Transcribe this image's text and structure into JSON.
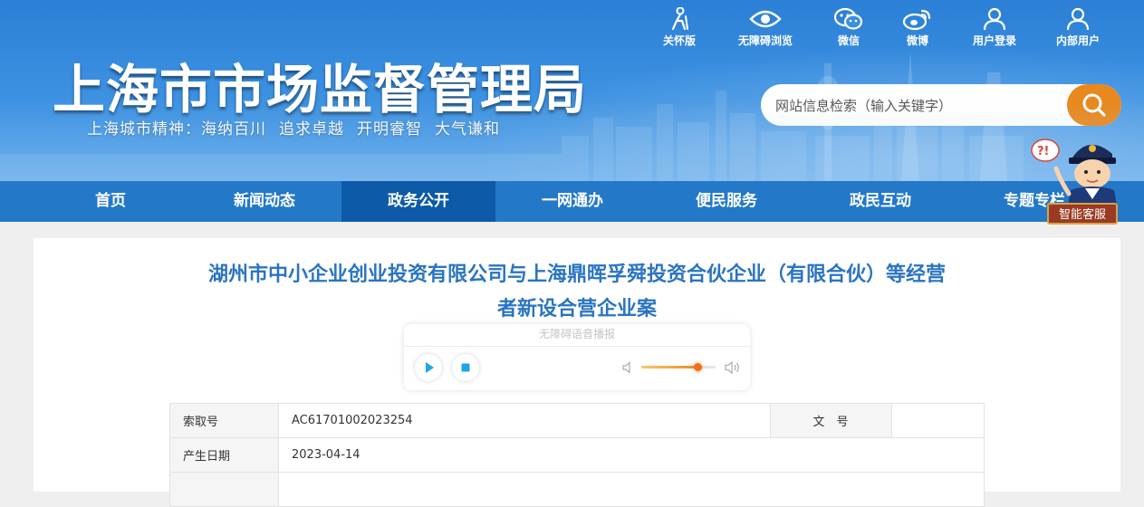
{
  "header": {
    "site_title": "上海市市场监督管理局",
    "motto_prefix": "上海城市精神：",
    "motto_items": [
      "海纳百川",
      "追求卓越",
      "开明睿智",
      "大气谦和"
    ],
    "top_links": [
      {
        "label": "关怀版",
        "icon": "elderly-care-icon"
      },
      {
        "label": "无障碍浏览",
        "icon": "eye-icon"
      },
      {
        "label": "微信",
        "icon": "wechat-icon"
      },
      {
        "label": "微博",
        "icon": "weibo-icon"
      },
      {
        "label": "用户登录",
        "icon": "user-icon"
      },
      {
        "label": "内部用户",
        "icon": "user-icon"
      }
    ],
    "search": {
      "placeholder": "网站信息检索（输入关键字）",
      "value": "",
      "icon": "search-icon"
    }
  },
  "nav": {
    "items": [
      "首页",
      "新闻动态",
      "政务公开",
      "一网通办",
      "便民服务",
      "政民互动",
      "专题专栏"
    ],
    "active_index": 2
  },
  "assistant": {
    "label": "智能客服",
    "bubble_text": "?!"
  },
  "article": {
    "title_line1": "湖州市中小企业创业投资有限公司与上海鼎晖孚舜投资合伙企业（有限合伙）等经营",
    "title_line2": "者新设合营企业案",
    "audio": {
      "caption": "无障碍语音播报",
      "volume": 0.76
    },
    "meta": {
      "index_no_label": "索取号",
      "index_no_value": "AC61701002023254",
      "doc_no_label": "文　号",
      "doc_no_value": "",
      "date_label": "产生日期",
      "date_value": "2023-04-14"
    }
  },
  "colors": {
    "banner_blue": "#2b7fd6",
    "nav_blue": "#2478c8",
    "nav_active": "#0d5aa8",
    "search_orange": "#e8881e",
    "title_blue": "#2a74c2",
    "play_cyan": "#1aa6e8"
  }
}
